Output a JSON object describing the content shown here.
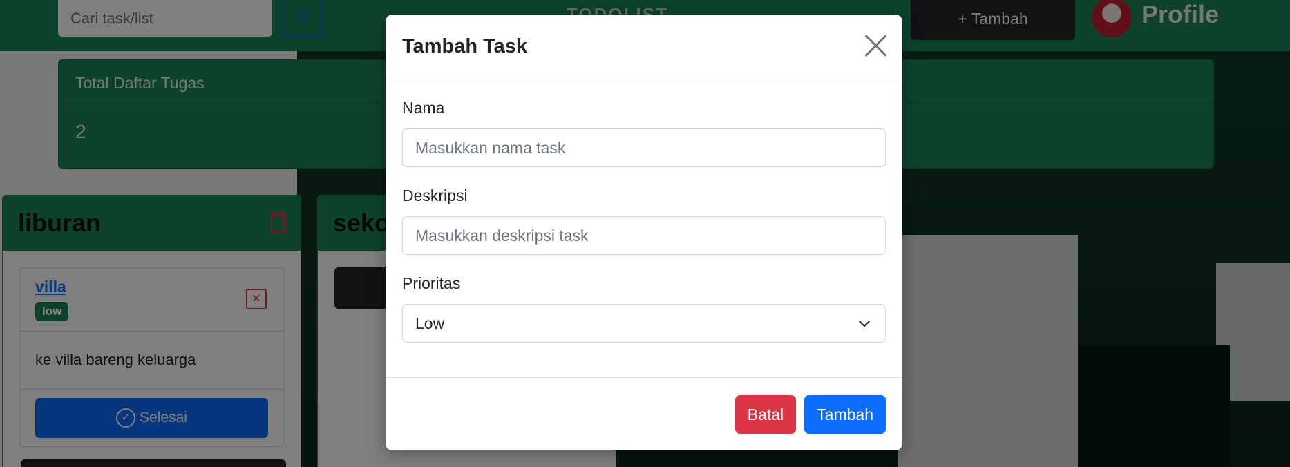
{
  "navbar": {
    "search_placeholder": "Cari task/list",
    "search_icon": "search-icon",
    "brand": "TODOLIST",
    "add_button": "+ Tambah",
    "profile_label": "Profile"
  },
  "stats": {
    "header": "Total Daftar Tugas",
    "value": "2"
  },
  "lists": [
    {
      "title": "liburan",
      "tasks": [
        {
          "name": "villa",
          "priority": "low",
          "description": "ke villa bareng keluarga",
          "done_label": "Selesai"
        }
      ]
    },
    {
      "title": "seko"
    }
  ],
  "modal": {
    "title": "Tambah Task",
    "fields": {
      "name_label": "Nama",
      "name_placeholder": "Masukkan nama task",
      "desc_label": "Deskripsi",
      "desc_placeholder": "Masukkan deskripsi task",
      "priority_label": "Prioritas",
      "priority_value": "Low"
    },
    "cancel_label": "Batal",
    "submit_label": "Tambah"
  },
  "colors": {
    "success": "#198754",
    "primary": "#0d6efd",
    "danger": "#dc3545",
    "dark": "#212529"
  }
}
